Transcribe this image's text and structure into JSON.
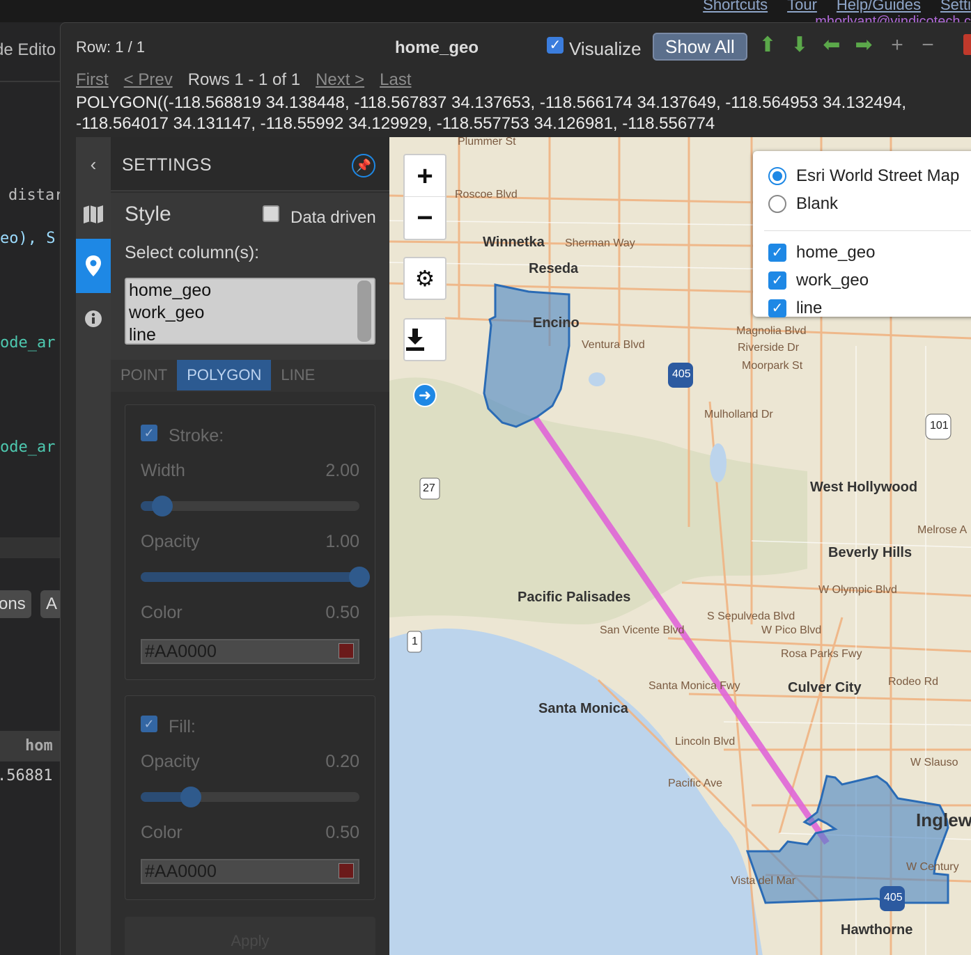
{
  "top": {
    "links": [
      "Shortcuts",
      "Tour",
      "Help/Guides",
      "Setti"
    ],
    "user": "mhorlyant@vindicotech.c"
  },
  "background": {
    "title": "de Edito",
    "code_lines": [
      "distar",
      "eo), S",
      "ode_ar",
      "ode_ar"
    ],
    "tabs": [
      "ons",
      "A"
    ],
    "column_header": "hom",
    "cell_value": ".56881"
  },
  "viewer": {
    "row_label": "Row: 1 / 1",
    "title": "home_geo",
    "visualize_label": "Visualize",
    "show_all_label": "Show All",
    "pager": {
      "first": "First",
      "prev": "< Prev",
      "rows": "Rows 1 - 1 of 1",
      "next": "Next >",
      "last": "Last"
    },
    "wkt_text": "POLYGON((-118.568819 34.138448, -118.567837 34.137653, -118.566174 34.137649, -118.564953 34.132494, -118.564017 34.131147, -118.55992 34.129929, -118.557753 34.126981, -118.556774"
  },
  "settings": {
    "title": "SETTINGS",
    "style_label": "Style",
    "data_driven_label": "Data driven",
    "select_columns_label": "Select column(s):",
    "columns": [
      "home_geo",
      "work_geo",
      "line"
    ],
    "geom_tabs": [
      "POINT",
      "POLYGON",
      "LINE"
    ],
    "active_geom_tab": "POLYGON",
    "stroke": {
      "title": "Stroke:",
      "width_label": "Width",
      "width_value": "2.00",
      "width_fraction": 0.1,
      "opacity_label": "Opacity",
      "opacity_value": "1.00",
      "opacity_fraction": 1.0,
      "color_label": "Color",
      "color_value": "0.50",
      "color_hex": "#AA0000"
    },
    "fill": {
      "title": "Fill:",
      "opacity_label": "Opacity",
      "opacity_value": "0.20",
      "opacity_fraction": 0.23,
      "color_label": "Color",
      "color_value": "0.50",
      "color_hex": "#AA0000"
    },
    "apply_label": "Apply"
  },
  "map": {
    "basemaps": [
      "Esri World Street Map",
      "Blank"
    ],
    "selected_basemap": "Esri World Street Map",
    "layers": [
      "home_geo",
      "work_geo",
      "line"
    ],
    "labels": {
      "winnetka": "Winnetka",
      "reseda": "Reseda",
      "encino": "Encino",
      "west_hollywood": "West Hollywood",
      "beverly_hills": "Beverly Hills",
      "pacific_palisades": "Pacific Palisades",
      "santa_monica": "Santa Monica",
      "culver_city": "Culver City",
      "inglewood": "Inglew",
      "hawthorne": "Hawthorne",
      "roscoe": "Roscoe Blvd",
      "sherman": "Sherman Way",
      "ventura": "Ventura Blvd",
      "mulholland": "Mulholland Dr",
      "olympic": "W Olympic Blvd",
      "pico": "W Pico Blvd",
      "rosa_parks": "Rosa Parks Fwy",
      "lincoln": "Lincoln Blvd",
      "pacific_ave": "Pacific Ave",
      "vista": "Vista del Mar",
      "plummer": "Plummer St",
      "magnolia": "Magnolia Blvd",
      "riverside": "Riverside Dr",
      "moorpark": "Moorpark St",
      "century": "W Century",
      "santa_monica_fwy": "Santa Monica Fwy",
      "sepulveda": "S Sepulveda Blvd",
      "san_vicente": "San Vicente Blvd",
      "melrose": "Melrose A",
      "rodeo": "Rodeo Rd",
      "slauson": "W Slauso",
      "i405": "405",
      "us101": "101",
      "r27": "27",
      "r1": "1"
    }
  }
}
